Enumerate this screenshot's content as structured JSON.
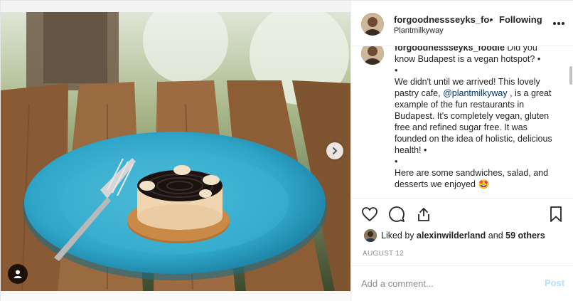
{
  "header": {
    "username": "forgoodnessseyks_foodie",
    "separator": "•",
    "follow_status": "Following",
    "location": "Plantmilkyway"
  },
  "caption": {
    "username": "forgoodnessseyks_foodie",
    "line1": "Did you know Budapest is a vegan hotspot? •",
    "bullet1": "•",
    "body_part1": "We didn't until we arrived! This lovely pastry cafe,",
    "mention": "@plantmilkyway",
    "body_part2": ", is a great example of the fun restaurants in Budapest. It's completely vegan, gluten free and refined sugar free. It was founded on the idea of holistic, delicious health! •",
    "bullet2": "•",
    "body_part3": "Here are some sandwiches, salad, and desserts we enjoyed",
    "emoji": "🤩"
  },
  "likes": {
    "prefix": "Liked by",
    "user": "alexinwilderland",
    "and": "and",
    "others": "59 others"
  },
  "date": "AUGUST 12",
  "comment": {
    "placeholder": "Add a comment...",
    "post_label": "Post"
  },
  "icons": {
    "like": "heart-icon",
    "comment": "comment-icon",
    "share": "share-icon",
    "save": "bookmark-icon",
    "more": "more-icon",
    "next": "chevron-right-icon",
    "user_tag": "user-icon"
  },
  "colors": {
    "link": "#003569",
    "post_button": "#b2dffc",
    "muted": "#8e8e8e",
    "plate": "#2fa6c9"
  }
}
